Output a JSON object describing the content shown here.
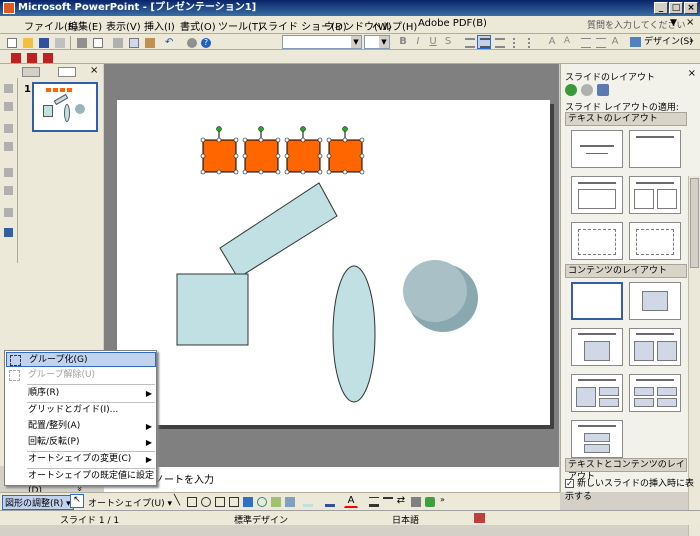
{
  "window": {
    "title": "Microsoft PowerPoint - [プレゼンテーション1]"
  },
  "menu": [
    "ファイル(F)",
    "編集(E)",
    "表示(V)",
    "挿入(I)",
    "書式(O)",
    "ツール(T)",
    "スライド ショー(D)",
    "ウィンドウ(W)",
    "ヘルプ(H)",
    "Adobe PDF(B)"
  ],
  "ask_box": "質問を入力してください",
  "toolbar": {
    "design_label": "デザイン(S)"
  },
  "left_pane": {
    "slide_number": "1"
  },
  "notes": {
    "placeholder": "ノートを入力"
  },
  "task_pane": {
    "title": "スライドのレイアウト",
    "apply_label": "スライド レイアウトの適用:",
    "section_text": "テキストのレイアウト",
    "section_content": "コンテンツのレイアウト",
    "section_text_content": "テキストとコンテンツのレイアウト",
    "show_on_insert": "新しいスライドの挿入時に表示する"
  },
  "context_menu": {
    "group": "グループ化(G)",
    "ungroup": "グループ解除(U)",
    "order": "順序(R)",
    "grid": "グリッドとガイド(I)...",
    "align": "配置/整列(A)",
    "rotate": "回転/反転(P)",
    "change_autoshape": "オートシェイプの変更(C)",
    "set_default": "オートシェイプの既定値に設定(D)",
    "more": "»"
  },
  "drawing_toolbar": {
    "draw_menu": "図形の調整(R)",
    "autoshape_menu": "オートシェイプ(U)"
  },
  "status": {
    "slide": "スライド 1 / 1",
    "design": "標準デザイン",
    "language": "日本語"
  },
  "colors": {
    "orange": "#ff6600",
    "shape_fill": "#c0e0e4",
    "cylinder": "#9ab4bc",
    "selection": "#c1d2ee"
  }
}
